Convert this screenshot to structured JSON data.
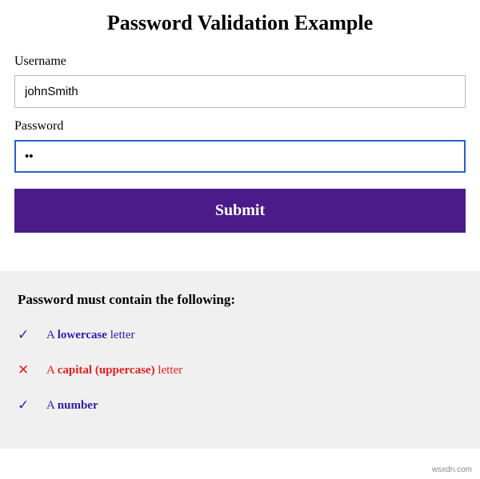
{
  "page": {
    "title": "Password Validation Example"
  },
  "form": {
    "username_label": "Username",
    "username_value": "johnSmith",
    "password_label": "Password",
    "password_value": "••",
    "submit_label": "Submit"
  },
  "requirements": {
    "title": "Password must contain the following:",
    "items": [
      {
        "status": "valid",
        "icon": "✓",
        "prefix": "A ",
        "highlight": "lowercase",
        "suffix": " letter"
      },
      {
        "status": "invalid",
        "icon": "✕",
        "prefix": "A ",
        "highlight": "capital (uppercase)",
        "suffix": " letter"
      },
      {
        "status": "valid",
        "icon": "✓",
        "prefix": "A ",
        "highlight": "number",
        "suffix": ""
      }
    ]
  },
  "watermark": "wsxdn.com"
}
